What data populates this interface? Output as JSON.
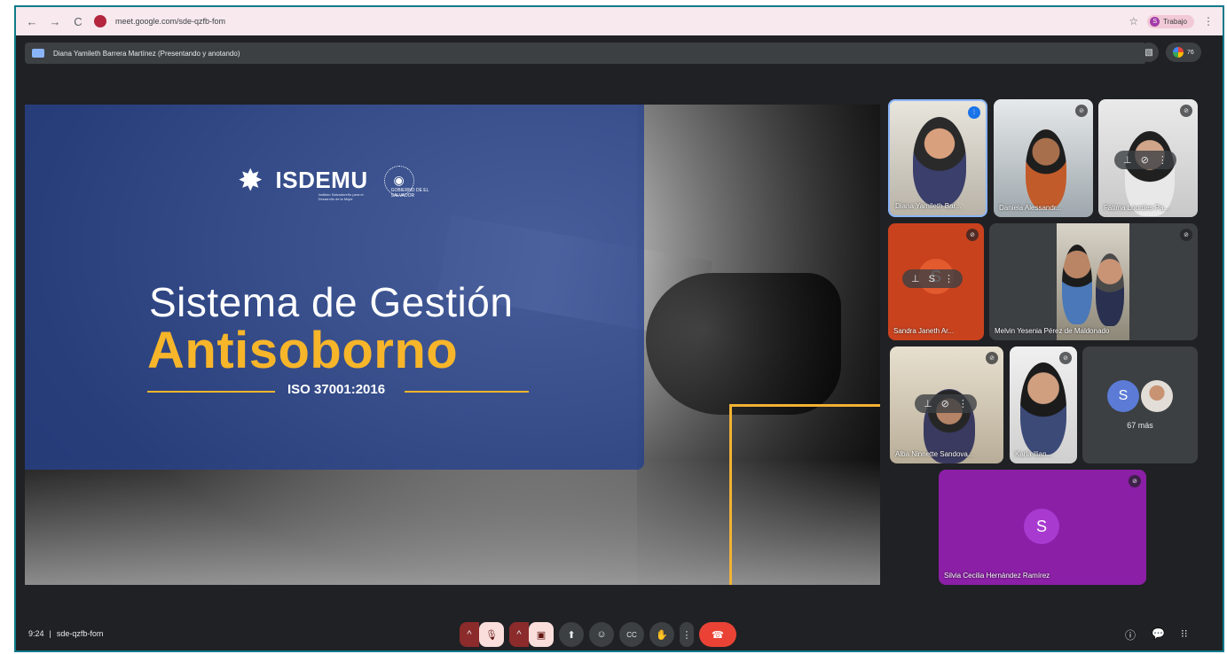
{
  "browser": {
    "back": "←",
    "forward": "→",
    "reload": "C",
    "url": "meet.google.com/sde-qzfb-fom",
    "star": "☆",
    "profile_initial": "S",
    "profile_label": "Trabajo",
    "menu": "⋮"
  },
  "presenter": {
    "text": "Diana Yamileth Barrera Martínez (Presentando y anotando)"
  },
  "top_right": {
    "participants_count": "76"
  },
  "slide": {
    "brand": "ISDEMU",
    "brand_sub": "Instituto Salvadoreño para el Desarrollo de la Mujer",
    "seal_text": "GOBIERNO DE EL SALVADOR",
    "title": "Sistema de Gestión",
    "headline": "Antisoborno",
    "standard": "ISO 37001:2016"
  },
  "participants": [
    {
      "name": "Diana Yamileth Bar...",
      "speaking": true
    },
    {
      "name": "Daniela Alessandr...",
      "muted": true
    },
    {
      "name": "Fátima Lourdes Pa...",
      "muted": true
    },
    {
      "name": "Sandra Janeth Ar...",
      "muted": true,
      "avatar": "S"
    },
    {
      "name": "Melvin Yesenia Pérez de Maldonado",
      "muted": true
    },
    {
      "name": "Alba Ninnette Sandova...",
      "muted": true
    },
    {
      "name": "Karla Ilian...",
      "muted": true
    },
    {
      "more_initial": "S",
      "more_label": "67 más"
    },
    {
      "name": "Silvia Cecilia Hernández Ramírez",
      "muted": true,
      "avatar": "S"
    }
  ],
  "meeting": {
    "time": "9:24",
    "separator": "|",
    "code": "sde-qzfb-fom"
  },
  "controls": {
    "chevron": "^",
    "mic_off": "🎙",
    "cam_off": "▣",
    "present": "⬆",
    "emoji": "☺",
    "captions": "CC",
    "hand": "✋",
    "more": "⋮",
    "hangup": "☎"
  },
  "bottom_right": {
    "info": "ⓘ",
    "chat": "💬",
    "activities": "⁝⁝"
  },
  "colors": {
    "accent": "#f7b52a",
    "slide_blue": "#26428c",
    "hangup_red": "#ea4335",
    "tile_orange": "#c9421e",
    "tile_purple": "#8b1fa6"
  }
}
